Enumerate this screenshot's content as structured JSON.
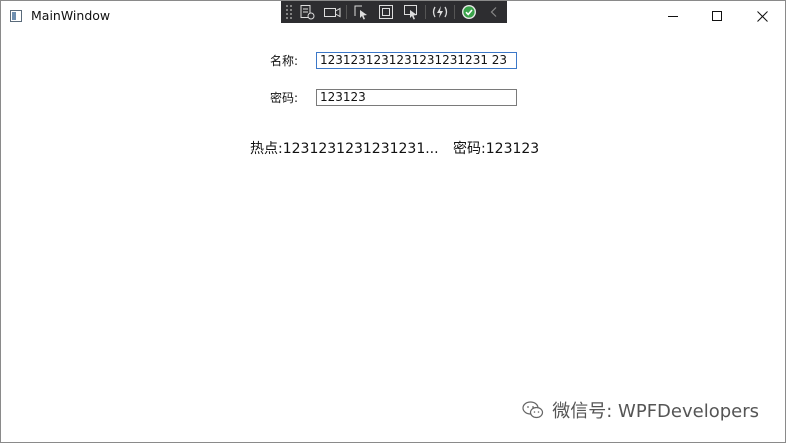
{
  "window": {
    "title": "MainWindow"
  },
  "form": {
    "name_label": "名称:",
    "name_value": "1231231231231231231231 23",
    "password_label": "密码:",
    "password_value": "123123"
  },
  "summary": {
    "hotspot_label": "热点:",
    "hotspot_value": "1231231231231231...",
    "password_label": "密码:",
    "password_value": "123123"
  },
  "watermark": {
    "text": "微信号: WPFDevelopers"
  },
  "debug_toolbar": {
    "icons": [
      "live-visual-tree-icon",
      "camera-icon",
      "select-element-icon",
      "display-layout-adorners-icon",
      "track-focus-icon",
      "hot-reload-icon",
      "checkmark-icon",
      "collapse-icon"
    ]
  }
}
